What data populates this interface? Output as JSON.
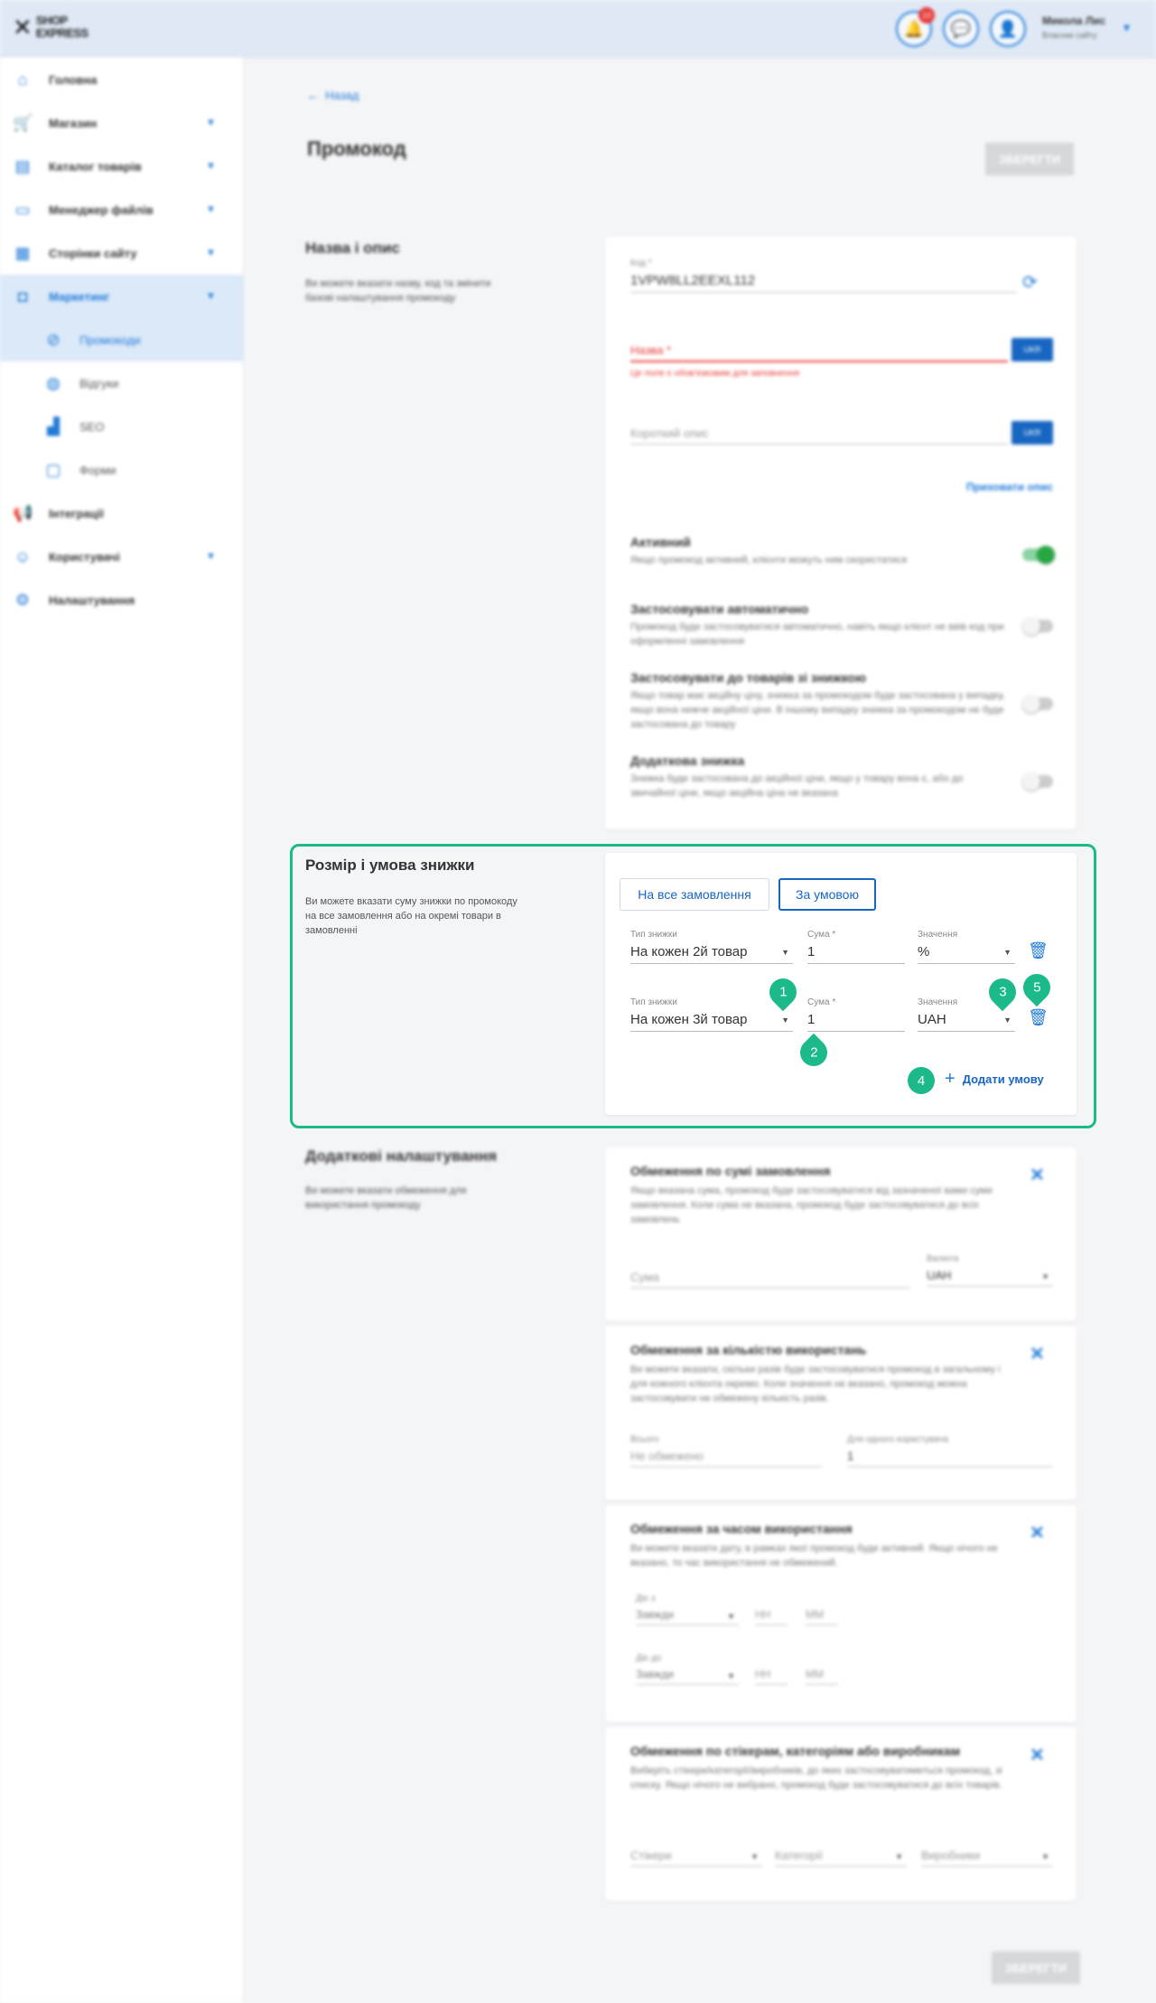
{
  "topbar": {
    "logo_text": "SHOP EXPRESS",
    "notifications_count": "10",
    "user_name": "Микола Лис",
    "user_role": "Власник сайту"
  },
  "sidebar": {
    "items": [
      {
        "label": "Головна",
        "icon": "home-icon"
      },
      {
        "label": "Магазин",
        "icon": "cart-icon"
      },
      {
        "label": "Каталог товарів",
        "icon": "book-icon"
      },
      {
        "label": "Менеджер файлів",
        "icon": "folder-icon"
      },
      {
        "label": "Сторінки сайту",
        "icon": "pages-icon"
      },
      {
        "label": "Маркетинг",
        "icon": "marketing-icon"
      },
      {
        "label": "Промокоди",
        "icon": "promo-icon"
      },
      {
        "label": "Відгуки",
        "icon": "reviews-icon"
      },
      {
        "label": "SEO",
        "icon": "seo-icon"
      },
      {
        "label": "Форми",
        "icon": "forms-icon"
      },
      {
        "label": "Інтеграції",
        "icon": "megaphone-icon"
      },
      {
        "label": "Користувачі",
        "icon": "users-icon"
      },
      {
        "label": "Налаштування",
        "icon": "gear-icon"
      }
    ]
  },
  "header": {
    "back_label": "Назад",
    "page_title": "Промокод",
    "save_label": "ЗБЕРЕГТИ"
  },
  "name_section": {
    "title": "Назва і опис",
    "description": "Ви можете вказати назву, код та змінити базові налаштування промокоду",
    "code_label": "Код *",
    "code_value": "1VPW8LL2EEXL112",
    "name_label": "Назва *",
    "name_error": "Це поле є обов'язковим для заповнення",
    "lang_button": "UKR",
    "short_desc_placeholder": "Короткий опис",
    "hide_desc_link": "Приховати опис",
    "toggles": [
      {
        "title": "Активний",
        "desc": "Якщо промокод активний, клієнти можуть ним скористатися",
        "on": true
      },
      {
        "title": "Застосовувати автоматично",
        "desc": "Промокод буде застосовуватися автоматично, навіть якщо клієнт не ввів код при оформленні замовлення",
        "on": false
      },
      {
        "title": "Застосовувати до товарів зі знижкою",
        "desc": "Якщо товар має акційну ціну, знижка за промокодом буде застосована у випадку, якщо вона нижче акційної ціни. В іншому випадку знижка за промокодом не буде застосована до товару",
        "on": false
      },
      {
        "title": "Додаткова знижка",
        "desc": "Знижка буде застосована до акційної ціни, якщо у товару вона є, або до звичайної ціни, якщо акційна ціна не вказана",
        "on": false
      }
    ]
  },
  "discount_section": {
    "title": "Розмір і умова знижки",
    "description": "Ви можете вказати суму знижки по промокоду на все замовлення або на окремі товари в замовленні",
    "tab_all": "На все замовлення",
    "tab_condition": "За умовою",
    "type_label": "Тип знижки",
    "amount_label": "Сума *",
    "value_label": "Значення",
    "rows": [
      {
        "type": "На кожен 2й товар",
        "amount": "1",
        "value": "%"
      },
      {
        "type": "На кожен 3й товар",
        "amount": "1",
        "value": "UAH"
      }
    ],
    "add_condition": "Додати умову",
    "markers": [
      "1",
      "2",
      "3",
      "4",
      "5"
    ]
  },
  "extra_section": {
    "title": "Додаткові налаштування",
    "description": "Ви можете вказати обмеження для використання промокоду",
    "blocks": [
      {
        "title": "Обмеження по сумі замовлення",
        "desc": "Якщо вказана сума, промокод буде застосовуватися від зазначеної вами суми замовлення. Коли сума не вказана, промокод буде застосовуватися до всіх замовлень"
      },
      {
        "title": "Обмеження за кількістю використань",
        "desc": "Ви можете вказати, скільки разів буде застосовуватися промокод в загальному і для кожного клієнта окремо. Коли значення не вказано, промокод можна застосовувати не обмежену кількість разів."
      },
      {
        "title": "Обмеження за часом використання",
        "desc": "Ви можете вказати дату, в рамках якої промокод буде активний. Якщо нічого не вказано, то час використання не обмежений."
      },
      {
        "title": "Обмеження по стікерам, категоріям або виробникам",
        "desc": "Виберіть стікери/категорії/виробників, до яких застосовуватиметься промокод, зі списку. Якщо нічого не вибрано, промокод буде застосовуватися до всіх товарів."
      }
    ],
    "sum_placeholder": "Сума",
    "currency_label": "Валюта",
    "currency_value": "UAH",
    "total_label": "Всього",
    "total_value": "Не обмежено",
    "per_user_label": "Для одного користувача",
    "per_user_value": "1",
    "from_label": "Діє з",
    "to_label": "Діє до",
    "always": "Завжди",
    "hh": "HH",
    "mm": "MM",
    "stickers": "Стікери",
    "categories": "Категорії",
    "manufacturers": "Виробники"
  },
  "colors": {
    "accent": "#1f7ad8",
    "highlight": "#1cb98a",
    "error": "#e53935",
    "toggle_on": "#28a745"
  }
}
